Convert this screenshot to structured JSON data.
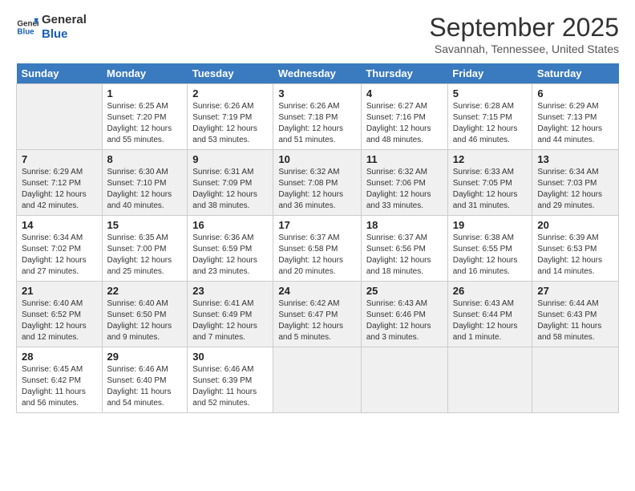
{
  "header": {
    "logo_line1": "General",
    "logo_line2": "Blue",
    "month": "September 2025",
    "location": "Savannah, Tennessee, United States"
  },
  "days_of_week": [
    "Sunday",
    "Monday",
    "Tuesday",
    "Wednesday",
    "Thursday",
    "Friday",
    "Saturday"
  ],
  "weeks": [
    [
      {
        "day": "",
        "info": ""
      },
      {
        "day": "1",
        "info": "Sunrise: 6:25 AM\nSunset: 7:20 PM\nDaylight: 12 hours\nand 55 minutes."
      },
      {
        "day": "2",
        "info": "Sunrise: 6:26 AM\nSunset: 7:19 PM\nDaylight: 12 hours\nand 53 minutes."
      },
      {
        "day": "3",
        "info": "Sunrise: 6:26 AM\nSunset: 7:18 PM\nDaylight: 12 hours\nand 51 minutes."
      },
      {
        "day": "4",
        "info": "Sunrise: 6:27 AM\nSunset: 7:16 PM\nDaylight: 12 hours\nand 48 minutes."
      },
      {
        "day": "5",
        "info": "Sunrise: 6:28 AM\nSunset: 7:15 PM\nDaylight: 12 hours\nand 46 minutes."
      },
      {
        "day": "6",
        "info": "Sunrise: 6:29 AM\nSunset: 7:13 PM\nDaylight: 12 hours\nand 44 minutes."
      }
    ],
    [
      {
        "day": "7",
        "info": "Sunrise: 6:29 AM\nSunset: 7:12 PM\nDaylight: 12 hours\nand 42 minutes."
      },
      {
        "day": "8",
        "info": "Sunrise: 6:30 AM\nSunset: 7:10 PM\nDaylight: 12 hours\nand 40 minutes."
      },
      {
        "day": "9",
        "info": "Sunrise: 6:31 AM\nSunset: 7:09 PM\nDaylight: 12 hours\nand 38 minutes."
      },
      {
        "day": "10",
        "info": "Sunrise: 6:32 AM\nSunset: 7:08 PM\nDaylight: 12 hours\nand 36 minutes."
      },
      {
        "day": "11",
        "info": "Sunrise: 6:32 AM\nSunset: 7:06 PM\nDaylight: 12 hours\nand 33 minutes."
      },
      {
        "day": "12",
        "info": "Sunrise: 6:33 AM\nSunset: 7:05 PM\nDaylight: 12 hours\nand 31 minutes."
      },
      {
        "day": "13",
        "info": "Sunrise: 6:34 AM\nSunset: 7:03 PM\nDaylight: 12 hours\nand 29 minutes."
      }
    ],
    [
      {
        "day": "14",
        "info": "Sunrise: 6:34 AM\nSunset: 7:02 PM\nDaylight: 12 hours\nand 27 minutes."
      },
      {
        "day": "15",
        "info": "Sunrise: 6:35 AM\nSunset: 7:00 PM\nDaylight: 12 hours\nand 25 minutes."
      },
      {
        "day": "16",
        "info": "Sunrise: 6:36 AM\nSunset: 6:59 PM\nDaylight: 12 hours\nand 23 minutes."
      },
      {
        "day": "17",
        "info": "Sunrise: 6:37 AM\nSunset: 6:58 PM\nDaylight: 12 hours\nand 20 minutes."
      },
      {
        "day": "18",
        "info": "Sunrise: 6:37 AM\nSunset: 6:56 PM\nDaylight: 12 hours\nand 18 minutes."
      },
      {
        "day": "19",
        "info": "Sunrise: 6:38 AM\nSunset: 6:55 PM\nDaylight: 12 hours\nand 16 minutes."
      },
      {
        "day": "20",
        "info": "Sunrise: 6:39 AM\nSunset: 6:53 PM\nDaylight: 12 hours\nand 14 minutes."
      }
    ],
    [
      {
        "day": "21",
        "info": "Sunrise: 6:40 AM\nSunset: 6:52 PM\nDaylight: 12 hours\nand 12 minutes."
      },
      {
        "day": "22",
        "info": "Sunrise: 6:40 AM\nSunset: 6:50 PM\nDaylight: 12 hours\nand 9 minutes."
      },
      {
        "day": "23",
        "info": "Sunrise: 6:41 AM\nSunset: 6:49 PM\nDaylight: 12 hours\nand 7 minutes."
      },
      {
        "day": "24",
        "info": "Sunrise: 6:42 AM\nSunset: 6:47 PM\nDaylight: 12 hours\nand 5 minutes."
      },
      {
        "day": "25",
        "info": "Sunrise: 6:43 AM\nSunset: 6:46 PM\nDaylight: 12 hours\nand 3 minutes."
      },
      {
        "day": "26",
        "info": "Sunrise: 6:43 AM\nSunset: 6:44 PM\nDaylight: 12 hours\nand 1 minute."
      },
      {
        "day": "27",
        "info": "Sunrise: 6:44 AM\nSunset: 6:43 PM\nDaylight: 11 hours\nand 58 minutes."
      }
    ],
    [
      {
        "day": "28",
        "info": "Sunrise: 6:45 AM\nSunset: 6:42 PM\nDaylight: 11 hours\nand 56 minutes."
      },
      {
        "day": "29",
        "info": "Sunrise: 6:46 AM\nSunset: 6:40 PM\nDaylight: 11 hours\nand 54 minutes."
      },
      {
        "day": "30",
        "info": "Sunrise: 6:46 AM\nSunset: 6:39 PM\nDaylight: 11 hours\nand 52 minutes."
      },
      {
        "day": "",
        "info": ""
      },
      {
        "day": "",
        "info": ""
      },
      {
        "day": "",
        "info": ""
      },
      {
        "day": "",
        "info": ""
      }
    ]
  ]
}
